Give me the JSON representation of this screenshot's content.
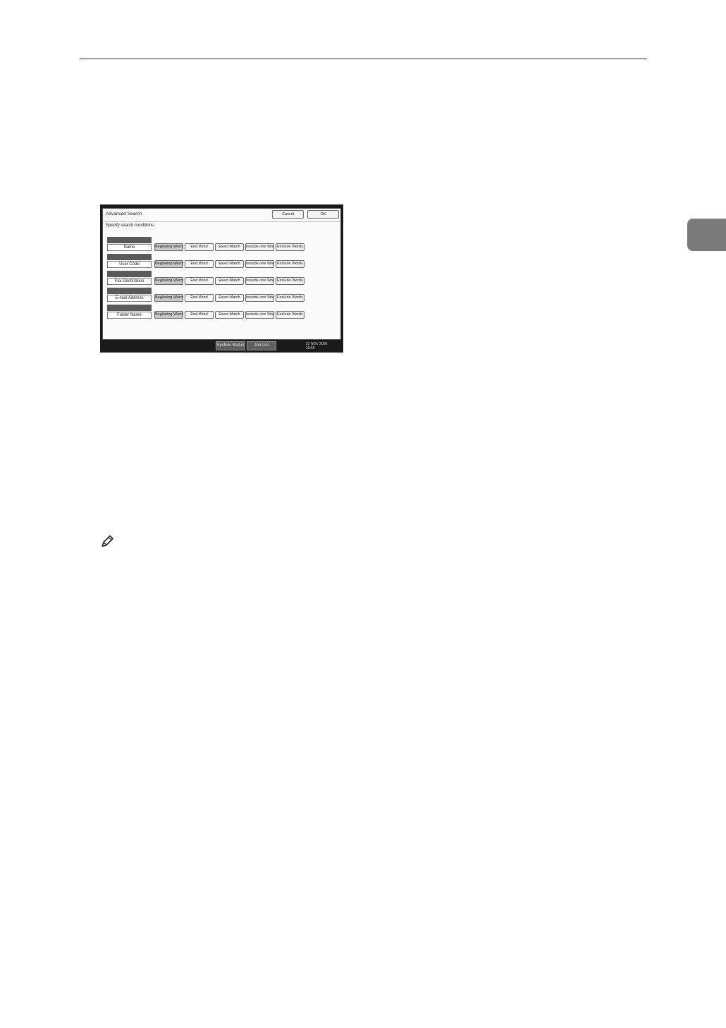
{
  "screen": {
    "title": "Advanced Search",
    "cancel_label": "Cancel",
    "ok_label": "OK",
    "subtitle": "Specify search conditions.",
    "options": [
      "Beginning Word",
      "End Word",
      "Exact Match",
      "Include one Word",
      "Exclude Words"
    ],
    "fields": [
      {
        "label": "Name"
      },
      {
        "label": "User Code"
      },
      {
        "label": "Fax Destination"
      },
      {
        "label": "E-mail Address"
      },
      {
        "label": "Folder Name"
      }
    ],
    "status": {
      "system_status_label": "System Status",
      "job_list_label": "Job List",
      "date": "22 NOV 2006",
      "time": "15:59"
    }
  },
  "colors": {
    "side_tab": "#7a7a7a",
    "screen_frame": "#1a1a1a",
    "selected_option": "#c9c9c9"
  },
  "icons": {
    "note": "pencil-note-icon"
  }
}
